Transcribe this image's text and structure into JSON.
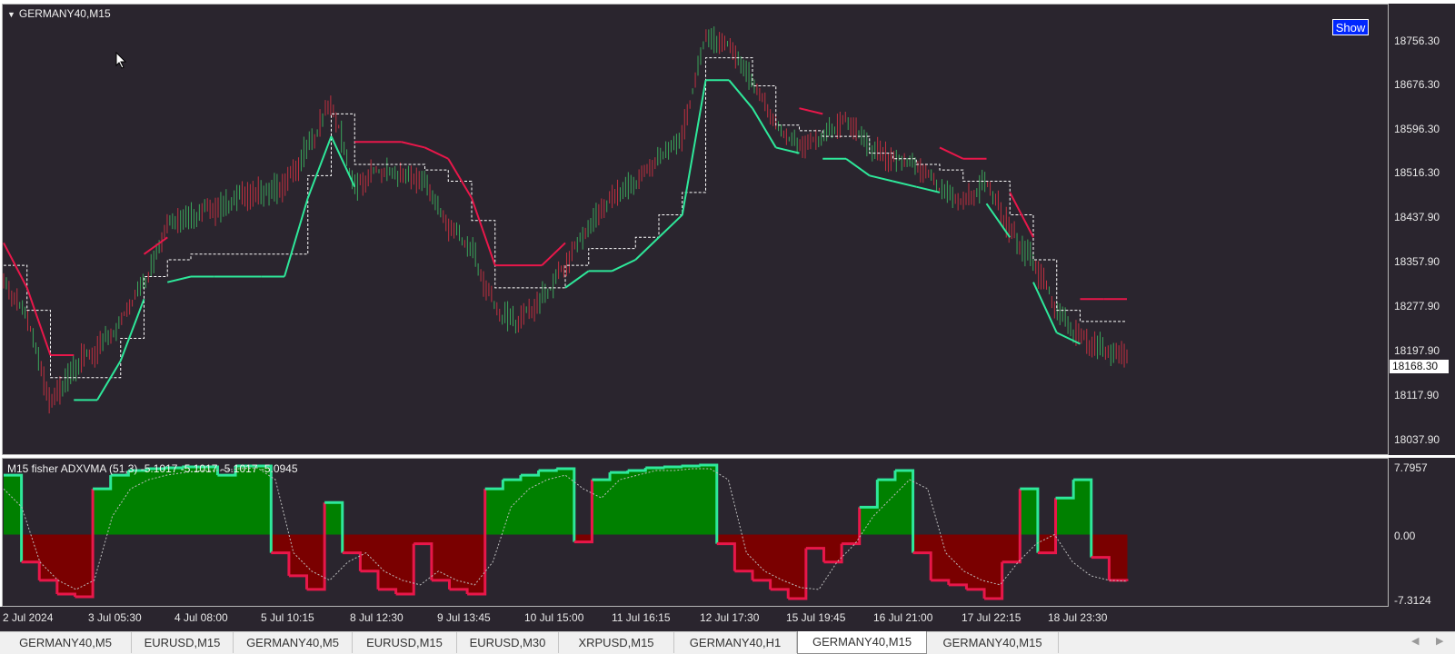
{
  "chart": {
    "title": "GERMANY40,M15",
    "show_button_label": "Show",
    "current_price": "18168.30",
    "price_labels": [
      "18756.30",
      "18676.30",
      "18596.30",
      "18516.30",
      "18437.90",
      "18357.90",
      "18277.90",
      "18197.90",
      "18117.90",
      "18037.90"
    ],
    "date_labels": [
      "2 Jul 2024",
      "3 Jul 05:30",
      "4 Jul 08:00",
      "5 Jul 10:15",
      "8 Jul 12:30",
      "9 Jul 13:45",
      "10 Jul 15:00",
      "11 Jul 16:15",
      "12 Jul 17:30",
      "15 Jul 19:45",
      "16 Jul 21:00",
      "17 Jul 22:15",
      "18 Jul 23:30"
    ]
  },
  "indicator": {
    "title": "M15 fisher ADXVMA (51,3) -5.1017 -5.1017 -5.1017 -5.0945",
    "levels": [
      "7.7957",
      "0.00",
      "-7.3124"
    ]
  },
  "colors": {
    "background": "#2a252e",
    "bull": "#2ee89a",
    "bear": "#e8174a",
    "fill_bull": "#008000",
    "fill_bear": "#7a0000",
    "candle_up": "#3aa55a",
    "candle_down": "#c03040"
  },
  "tabs": [
    {
      "label": "GERMANY40,M5",
      "active": false
    },
    {
      "label": "EURUSD,M15",
      "active": false
    },
    {
      "label": "GERMANY40,M5",
      "active": false
    },
    {
      "label": "EURUSD,M15",
      "active": false
    },
    {
      "label": "EURUSD,M30",
      "active": false
    },
    {
      "label": "XRPUSD,M15",
      "active": false
    },
    {
      "label": "GERMANY40,H1",
      "active": false
    },
    {
      "label": "GERMANY40,M15",
      "active": true
    },
    {
      "label": "GERMANY40,M15",
      "active": false
    }
  ],
  "chart_data": {
    "type": "line",
    "title": "GERMANY40,M15",
    "ylim": [
      18000,
      18790
    ],
    "series": [
      {
        "key": "price",
        "values": [
          18300,
          18240,
          18080,
          18150,
          18180,
          18230,
          18300,
          18400,
          18420,
          18430,
          18450,
          18460,
          18470,
          18540,
          18620,
          18470,
          18500,
          18490,
          18480,
          18400,
          18360,
          18250,
          18230,
          18270,
          18330,
          18400,
          18450,
          18480,
          18520,
          18560,
          18740,
          18720,
          18660,
          18580,
          18540,
          18560,
          18590,
          18540,
          18520,
          18510,
          18470,
          18440,
          18480,
          18390,
          18340,
          18250,
          18200,
          18180,
          18168
        ]
      },
      {
        "key": "trailing_line",
        "values": [
          18330,
          18250,
          18130,
          18130,
          18130,
          18200,
          18310,
          18340,
          18350,
          18350,
          18350,
          18350,
          18350,
          18490,
          18600,
          18510,
          18510,
          18510,
          18500,
          18480,
          18410,
          18290,
          18290,
          18290,
          18330,
          18360,
          18360,
          18380,
          18420,
          18460,
          18700,
          18700,
          18650,
          18580,
          18570,
          18560,
          18560,
          18530,
          18520,
          18510,
          18500,
          18480,
          18480,
          18420,
          18340,
          18250,
          18230,
          18230,
          18230
        ]
      },
      {
        "key": "signal_dots_level",
        "values": []
      }
    ],
    "indicator_series": [
      {
        "key": "fisher",
        "values": [
          6.5,
          -3,
          -5,
          -6.5,
          -6.8,
          5,
          6.5,
          7,
          7.2,
          7.3,
          7.4,
          7.4,
          6.5,
          7.5,
          7.5,
          -2,
          -4.5,
          -6,
          3.5,
          -2,
          -4,
          -6,
          -6.5,
          -1,
          -5,
          -6,
          -6.5,
          5,
          6,
          6.5,
          7,
          7.2,
          -0.8,
          6,
          6.8,
          7,
          7.3,
          7.4,
          7.5,
          7.6,
          -1,
          -4,
          -5,
          -6,
          -7,
          -1.5,
          -3,
          -1,
          3,
          6,
          7,
          -2,
          -5,
          -5.5,
          -6,
          -7,
          -3,
          5,
          -2,
          4,
          6,
          -2.5,
          -5,
          -5.1
        ]
      },
      {
        "key": "signal",
        "values": [
          5,
          3,
          -3,
          -5,
          -6,
          -5,
          2,
          5,
          6,
          6.5,
          6.8,
          7,
          7,
          7.2,
          7.3,
          6,
          -2,
          -4,
          -5,
          -3,
          -2,
          -4,
          -5,
          -5.5,
          -4,
          -5,
          -5.5,
          -3,
          3,
          5,
          6,
          6.5,
          5,
          4,
          6,
          6.5,
          7,
          7,
          7.2,
          7.2,
          6,
          -2,
          -4,
          -5,
          -5.8,
          -6,
          -3,
          -1,
          2,
          4,
          6,
          5,
          -2,
          -4,
          -5,
          -5.5,
          -3,
          -1,
          0,
          -3,
          -4.5,
          -5,
          -5.1
        ]
      }
    ]
  }
}
